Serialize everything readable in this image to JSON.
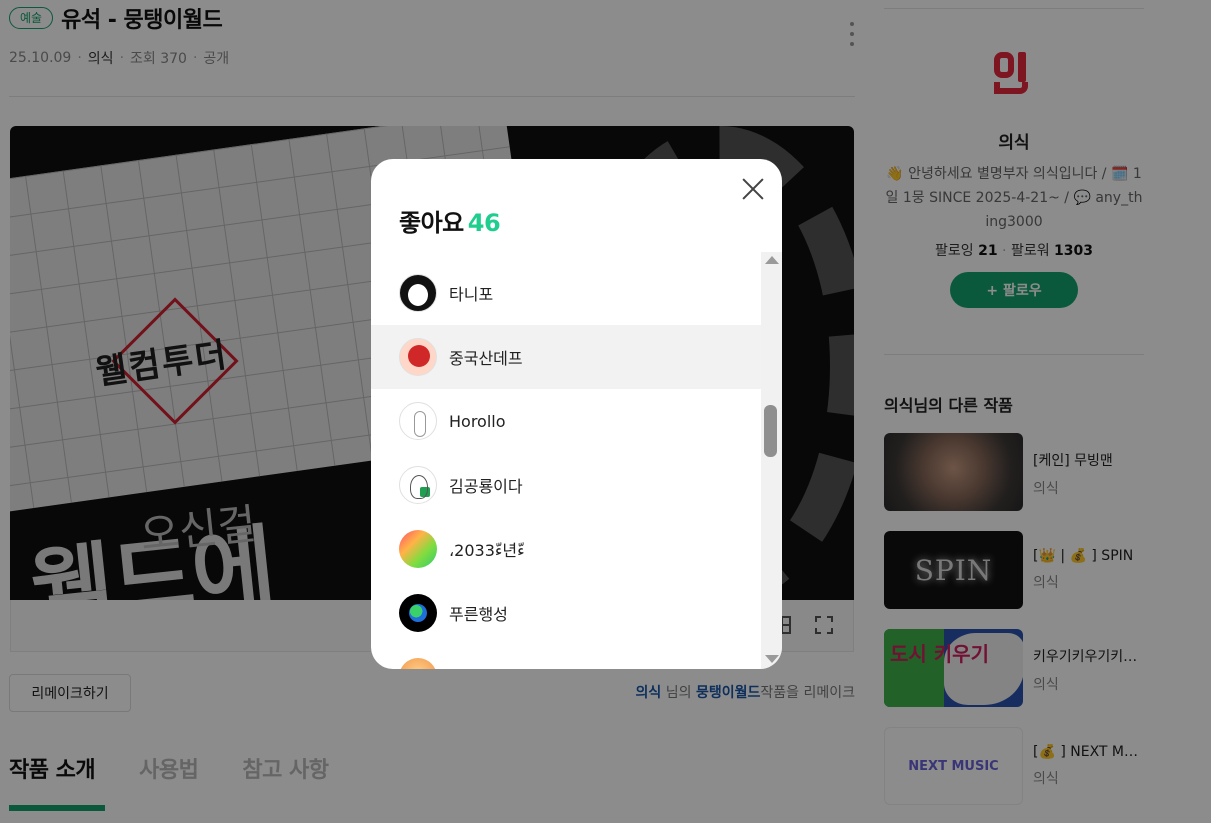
{
  "work": {
    "genre": "예술",
    "title": "유석 - 뭉탱이월드",
    "date": "25.10.09",
    "author": "의식",
    "views": "조회 370",
    "visibility": "공개"
  },
  "preview": {
    "welcome_text": "웰컴투더",
    "big_text": "웰드에",
    "fade_text": "오신걸"
  },
  "remake": {
    "button_label": "리메이크하기",
    "note_user": "의식",
    "note_mid": " 님의 ",
    "note_work": "뭉탱이월드",
    "note_end": "작품을 리메이크"
  },
  "tabs": [
    "작품 소개",
    "사용법",
    "참고 사항"
  ],
  "sidebar": {
    "profile_name": "의식",
    "bio": "👋 안녕하세요 별명부자 의식입니다 / 🗓️ 1일 1뭉 SINCE 2025-4-21~ / 💬 any_thing3000",
    "following_label": "팔로잉",
    "following_count": "21",
    "followers_label": "팔로워",
    "followers_count": "1303",
    "follow_button": "+ 팔로우",
    "other_works_title": "의식님의 다른 작품",
    "other_works": [
      {
        "title": "[케인] 무빙맨",
        "author": "의식",
        "thumb_text": ""
      },
      {
        "title": "[👑 | 💰 ] SPIN",
        "author": "의식",
        "thumb_text": "SPIN"
      },
      {
        "title": "키우기키우기키우기",
        "author": "의식",
        "thumb_text": "도시 키우기"
      },
      {
        "title": "[💰 ] NEXT MUSIC",
        "author": "의식",
        "thumb_text": "NEXT MUSIC"
      }
    ]
  },
  "modal": {
    "title": "좋아요",
    "count": "46",
    "users": [
      "타니포",
      "중국산데프",
      "Horollo",
      "김공룡이다",
      "،ءّ2033년ءّ",
      "푸른행성",
      ""
    ]
  },
  "colors": {
    "accent": "#14a36d",
    "count_green": "#1fce8f",
    "link_blue": "#1a57a8",
    "logo_red": "#e3283c"
  }
}
